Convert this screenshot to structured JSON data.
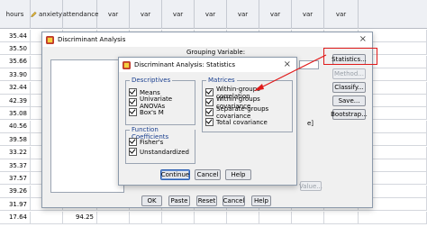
{
  "sheet": {
    "headers": [
      {
        "label": "hours",
        "icon": ""
      },
      {
        "label": "anxiety",
        "icon": "pencil-icon"
      },
      {
        "label": "attendance",
        "icon": "pencil-icon"
      },
      {
        "label": "var",
        "icon": ""
      },
      {
        "label": "var",
        "icon": ""
      },
      {
        "label": "var",
        "icon": ""
      },
      {
        "label": "var",
        "icon": ""
      },
      {
        "label": "var",
        "icon": ""
      },
      {
        "label": "var",
        "icon": ""
      },
      {
        "label": "var",
        "icon": ""
      },
      {
        "label": "var",
        "icon": ""
      }
    ],
    "hours_column": [
      "35.44",
      "35.50",
      "35.66",
      "33.90",
      "32.44",
      "42.39",
      "35.08",
      "40.56",
      "39.58",
      "33.22",
      "35.37",
      "37.57",
      "39.26",
      "31.97",
      "17.64"
    ],
    "last_row_col2": "94.25"
  },
  "main_dialog": {
    "title": "Discriminant Analysis",
    "grouping_label": "Grouping Variable:",
    "define_range_fragment": "e]",
    "value_button": "Value...",
    "side_buttons": [
      {
        "name": "statistics-button",
        "label": "Statistics...",
        "enabled": true
      },
      {
        "name": "method-button",
        "label": "Method...",
        "enabled": false
      },
      {
        "name": "classify-button",
        "label": "Classify...",
        "enabled": true
      },
      {
        "name": "save-button",
        "label": "Save...",
        "enabled": true
      },
      {
        "name": "bootstrap-button",
        "label": "Bootstrap...",
        "enabled": true
      }
    ],
    "bottom_buttons": [
      {
        "name": "ok-button",
        "label": "OK",
        "enabled": true,
        "primary": false
      },
      {
        "name": "paste-button",
        "label": "Paste",
        "enabled": true,
        "primary": false
      },
      {
        "name": "reset-button",
        "label": "Reset",
        "enabled": true,
        "primary": false
      },
      {
        "name": "cancel-button",
        "label": "Cancel",
        "enabled": true,
        "primary": false
      },
      {
        "name": "help-button",
        "label": "Help",
        "enabled": true,
        "primary": false
      }
    ]
  },
  "stats_dialog": {
    "title": "Discriminant Analysis: Statistics",
    "descriptives": {
      "label": "Descriptives",
      "items": [
        {
          "label": "Means",
          "checked": true
        },
        {
          "label": "Univariate ANOVAs",
          "checked": true
        },
        {
          "label": "Box's M",
          "checked": true
        }
      ]
    },
    "function_coefficients": {
      "label": "Function Coefficients",
      "items": [
        {
          "label": "Fisher's",
          "checked": true
        },
        {
          "label": "Unstandardized",
          "checked": true
        }
      ]
    },
    "matrices": {
      "label": "Matrices",
      "items": [
        {
          "label": "Within-groups correlation",
          "checked": true
        },
        {
          "label": "Within-groups covariance",
          "checked": true
        },
        {
          "label": "Separate-groups covariance",
          "checked": true
        },
        {
          "label": "Total covariance",
          "checked": true
        }
      ]
    },
    "buttons": [
      {
        "name": "continue-button",
        "label": "Continue",
        "primary": true
      },
      {
        "name": "stats-cancel-button",
        "label": "Cancel",
        "primary": false
      },
      {
        "name": "stats-help-button",
        "label": "Help",
        "primary": false
      }
    ]
  },
  "colors": {
    "annotation_red": "#e01a1a",
    "group_label": "#1a3f8f"
  }
}
